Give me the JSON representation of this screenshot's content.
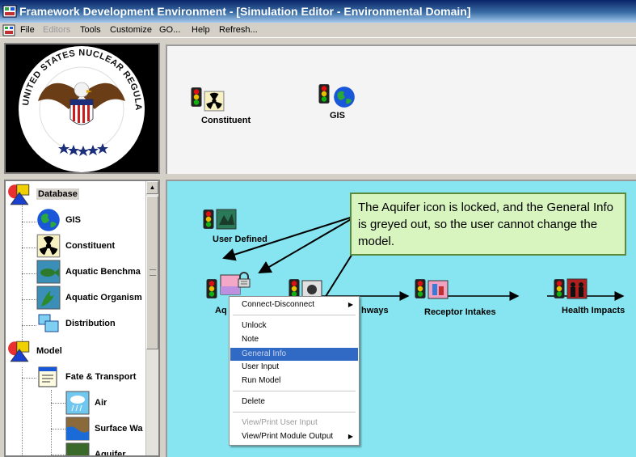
{
  "window": {
    "title": "Framework Development Environment - [Simulation Editor - Environmental Domain]"
  },
  "menubar": {
    "items": [
      {
        "label": "File",
        "disabled": false
      },
      {
        "label": "Editors",
        "disabled": true
      },
      {
        "label": "Tools",
        "disabled": false
      },
      {
        "label": "Customize",
        "disabled": false
      },
      {
        "label": "GO...",
        "disabled": false
      },
      {
        "label": "Help",
        "disabled": false
      },
      {
        "label": "Refresh...",
        "disabled": false
      }
    ]
  },
  "logo": {
    "text": "UNITED STATES NUCLEAR REGULATORY COMMISSION"
  },
  "top_canvas": {
    "nodes": [
      {
        "label": "Constituent",
        "icon": "constituent-icon"
      },
      {
        "label": "GIS",
        "icon": "globe-icon"
      }
    ]
  },
  "tree": {
    "items": [
      {
        "label": "Database",
        "icon": "category-icon",
        "selected": true
      },
      {
        "label": "GIS",
        "icon": "globe-icon"
      },
      {
        "label": "Constituent",
        "icon": "constituent-icon"
      },
      {
        "label": "Aquatic Benchma",
        "icon": "fish-icon"
      },
      {
        "label": "Aquatic Organism",
        "icon": "plant-icon"
      },
      {
        "label": "Distribution",
        "icon": "distribution-icon"
      },
      {
        "label": "Model",
        "icon": "category-icon"
      },
      {
        "label": "Fate & Transport",
        "icon": "document-icon"
      },
      {
        "label": "Air",
        "icon": "air-icon"
      },
      {
        "label": "Surface Wa",
        "icon": "surface-water-icon"
      },
      {
        "label": "Aquifer",
        "icon": "aquifer-icon"
      }
    ]
  },
  "main_canvas": {
    "nodes": {
      "user_defined": "User Defined",
      "aquifer": "Aq",
      "pathways": "hways",
      "receptor": "Receptor Intakes",
      "health": "Health Impacts"
    }
  },
  "callout": {
    "text": "The Aquifer icon is locked, and the General Info is greyed out, so the user cannot change the model."
  },
  "context_menu": {
    "items": [
      {
        "label": "Connect-Disconnect",
        "submenu": true
      },
      {
        "label": "Unlock"
      },
      {
        "label": "Note"
      },
      {
        "label": "General Info",
        "highlighted": true
      },
      {
        "label": "User Input"
      },
      {
        "label": "Run Model"
      },
      {
        "label": "Delete"
      },
      {
        "label": "View/Print User Input",
        "disabled": true
      },
      {
        "label": "View/Print Module Output",
        "submenu": true
      }
    ]
  },
  "colors": {
    "canvas": "#86e5f0",
    "callout_bg": "#d8f4bf",
    "highlight": "#316ac5"
  }
}
